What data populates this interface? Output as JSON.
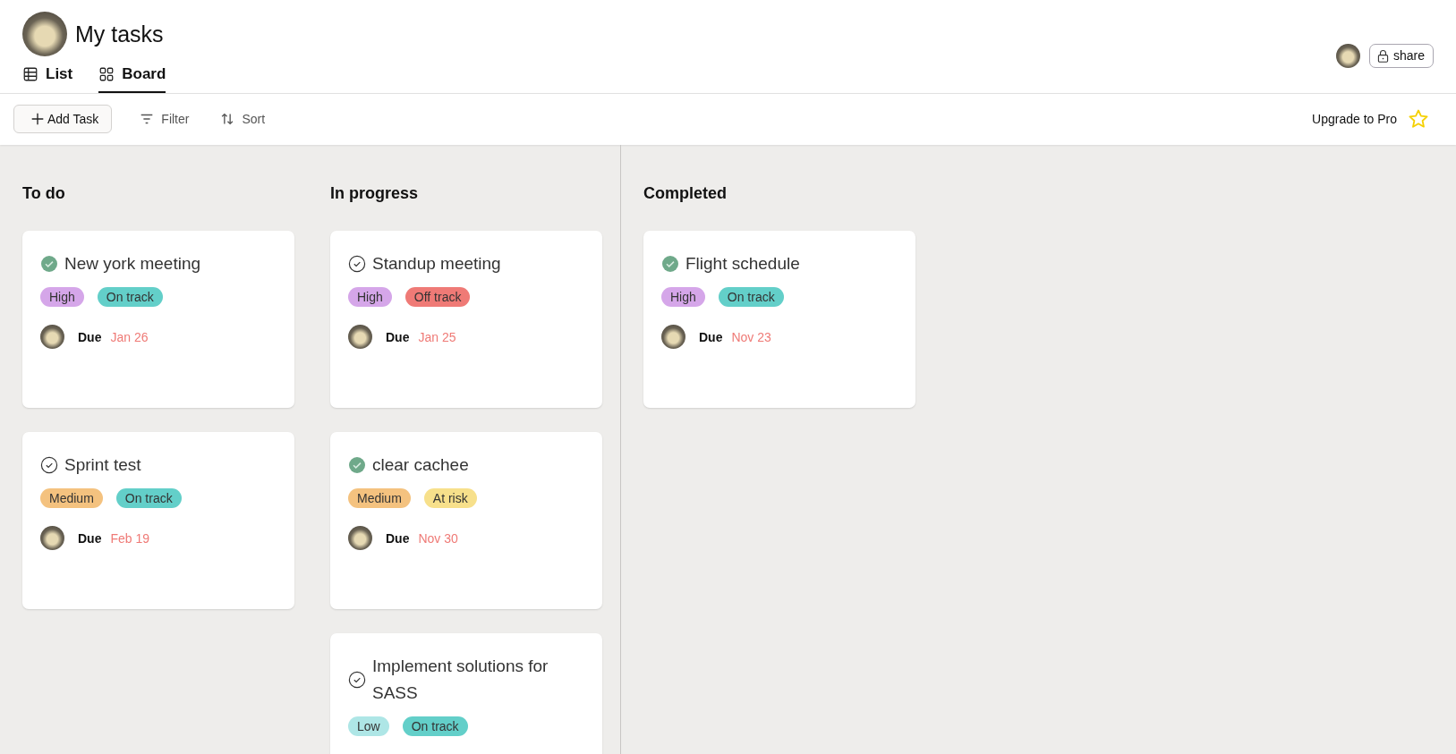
{
  "header": {
    "title": "My tasks",
    "share_button": "share"
  },
  "tabs": [
    {
      "label": "List",
      "kind": "table",
      "selected": false
    },
    {
      "label": "Board",
      "kind": "grid",
      "selected": true
    }
  ],
  "toolbar": {
    "add_task": "Add Task",
    "filter": "Filter",
    "sort": "Sort",
    "upgrade": "Upgrade to Pro"
  },
  "columns": [
    {
      "title": "To do",
      "cards": [
        {
          "title": "New york meeting",
          "completed": true,
          "tags": [
            {
              "label": "High",
              "color": "#d5a6e9"
            },
            {
              "label": "On track",
              "color": "#63cfc9"
            }
          ],
          "due_label": "Due",
          "due_date": "Jan 26"
        },
        {
          "title": "Sprint test",
          "completed": false,
          "tags": [
            {
              "label": "Medium",
              "color": "#f4c27f"
            },
            {
              "label": "On track",
              "color": "#63cfc9"
            }
          ],
          "due_label": "Due",
          "due_date": "Feb 19"
        }
      ]
    },
    {
      "title": "In progress",
      "cards": [
        {
          "title": "Standup meeting",
          "completed": false,
          "tags": [
            {
              "label": "High",
              "color": "#d5a6e9"
            },
            {
              "label": "Off track",
              "color": "#ef7a76"
            }
          ],
          "due_label": "Due",
          "due_date": "Jan 25"
        },
        {
          "title": "clear cachee",
          "completed": true,
          "tags": [
            {
              "label": "Medium",
              "color": "#f4c27f"
            },
            {
              "label": "At risk",
              "color": "#f7e08b"
            }
          ],
          "due_label": "Due",
          "due_date": "Nov 30"
        },
        {
          "title": "Implement solutions for SASS",
          "completed": false,
          "tags": [
            {
              "label": "Low",
              "color": "#aee6e6"
            },
            {
              "label": "On track",
              "color": "#63cfc9"
            }
          ]
        }
      ]
    },
    {
      "title": "Completed",
      "cards": [
        {
          "title": "Flight schedule",
          "completed": true,
          "tags": [
            {
              "label": "High",
              "color": "#d5a6e9"
            },
            {
              "label": "On track",
              "color": "#63cfc9"
            }
          ],
          "due_label": "Due",
          "due_date": "Nov 23"
        }
      ]
    }
  ]
}
